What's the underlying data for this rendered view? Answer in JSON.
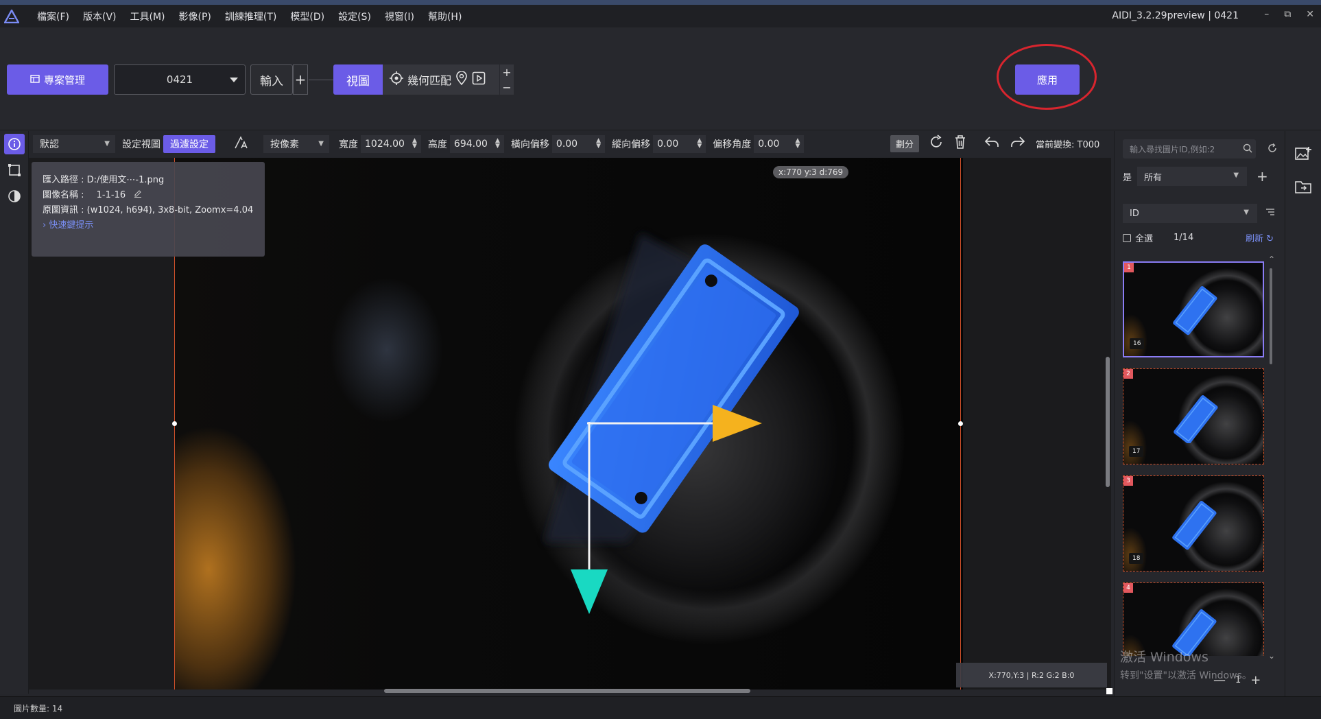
{
  "menu": {
    "items": [
      "檔案(F)",
      "版本(V)",
      "工具(M)",
      "影像(P)",
      "訓練推理(T)",
      "模型(D)",
      "設定(S)",
      "視窗(I)",
      "幫助(H)"
    ],
    "app_title": "AIDI_3.2.29preview | 0421"
  },
  "toolbar": {
    "project_button": "專案管理",
    "project_select": "0421",
    "input_button": "輸入",
    "plus": "+",
    "view_button": "視圖",
    "geometry_label": "幾何匹配",
    "minus": "−",
    "apply_button": "應用"
  },
  "image_toolbar": {
    "preset": "默認",
    "set_view": "設定視圖",
    "filter_settings": "過濾設定",
    "unit": "按像素",
    "width_label": "寬度",
    "width_value": "1024.00",
    "height_label": "高度",
    "height_value": "694.00",
    "h_offset_label": "橫向偏移",
    "h_offset_value": "0.00",
    "v_offset_label": "縱向偏移",
    "v_offset_value": "0.00",
    "angle_label": "偏移角度",
    "angle_value": "0.00",
    "split_button": "劃分",
    "current_transform": "當前變換: T000"
  },
  "info_panel": {
    "path": "匯入路徑 : D:/使用文⋯-1.png",
    "image_name_label": "圖像名稱 :",
    "image_name_value": "1-1-16",
    "original_info": "原圖資訊 : (w1024, h694), 3x8-bit, Zoomx=4.04",
    "shortcut_hint": "快速鍵提示"
  },
  "canvas": {
    "coord_pill": "x:770 y:3 d:769",
    "pixel_readout": "X:770,Y:3 | R:2 G:2 B:0"
  },
  "status_bar": {
    "image_count": "圖片數量:  14"
  },
  "right_panel": {
    "search_placeholder": "輸入尋找圖片ID,例如:2",
    "filter_prefix": "是",
    "filter_value": "所有",
    "sort_field": "ID",
    "select_all": "全選",
    "counter": "1/14",
    "refresh": "刷新",
    "thumbnails": [
      {
        "index": "1",
        "tag": "16"
      },
      {
        "index": "2",
        "tag": "17"
      },
      {
        "index": "3",
        "tag": "18"
      },
      {
        "index": "4",
        "tag": ""
      }
    ],
    "watermark_line1": "激活 Windows",
    "watermark_line2": "转到\"设置\"以激活 Windows。",
    "page": "1",
    "pager_minus": "—",
    "pager_plus": "+"
  },
  "colors": {
    "accent": "#6b5ce7",
    "ring": "#d8252e",
    "object_blue": "#2f6fe8",
    "arrow_x": "#f5b21e",
    "arrow_y": "#19d9c2"
  }
}
